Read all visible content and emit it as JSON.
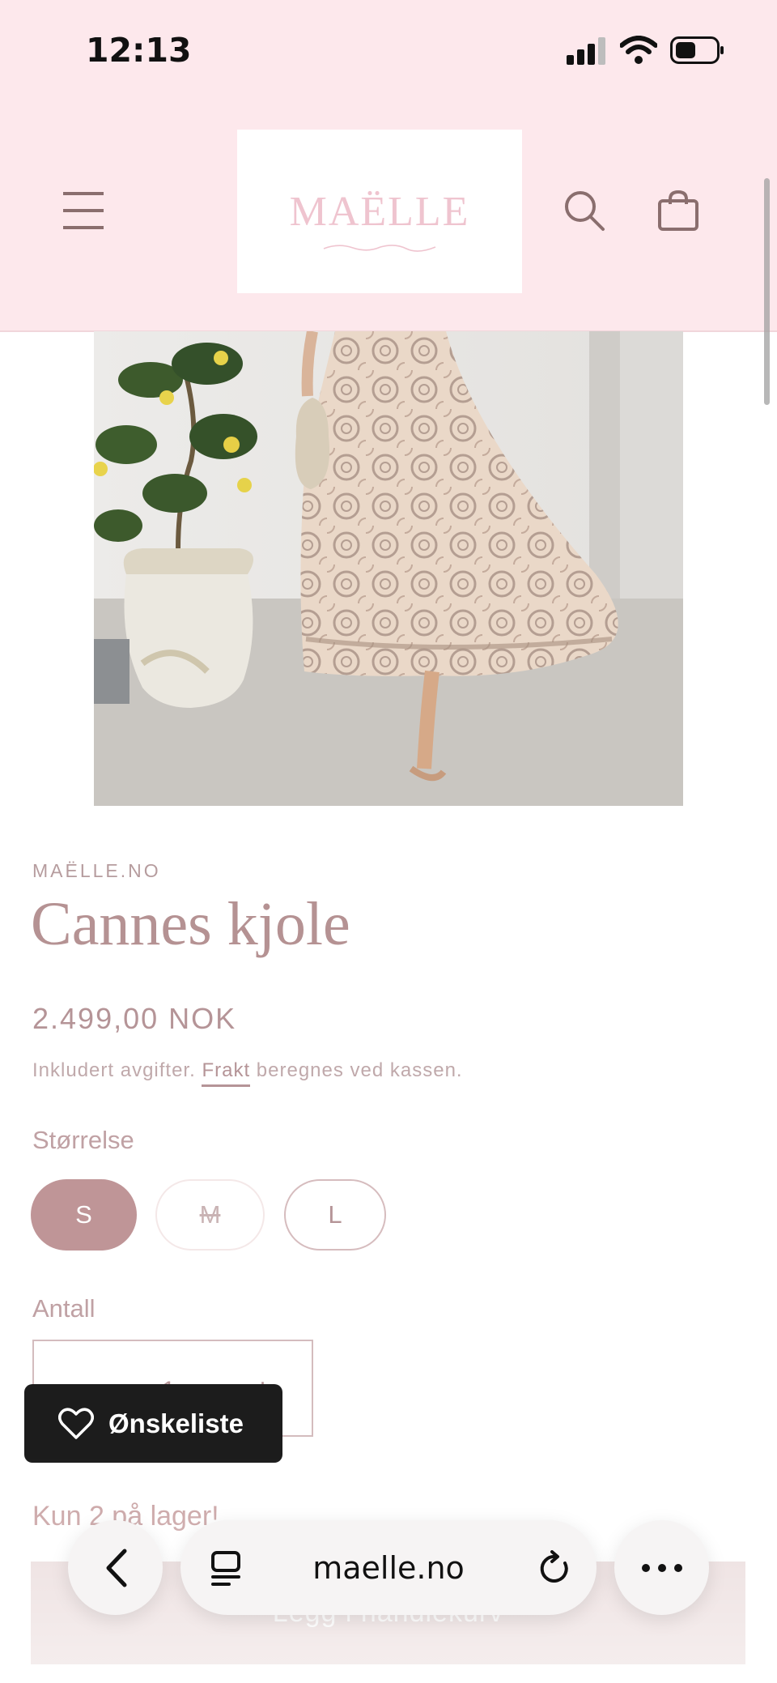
{
  "status_bar": {
    "time": "12:13"
  },
  "header": {
    "logo_text": "MAËLLE"
  },
  "product": {
    "vendor": "MAËLLE.NO",
    "title": "Cannes kjole",
    "price": "2.499,00 NOK",
    "tax_prefix": "Inkludert avgifter. ",
    "shipping_link": "Frakt",
    "tax_suffix": " beregnes ved kassen."
  },
  "size": {
    "label": "Størrelse",
    "options": [
      {
        "label": "S",
        "state": "selected"
      },
      {
        "label": "M",
        "state": "unavailable"
      },
      {
        "label": "L",
        "state": "available"
      }
    ]
  },
  "quantity": {
    "label": "Antall",
    "value": "1",
    "increase_symbol": "+"
  },
  "stock_note": "Kun 2 på lager!",
  "add_to_cart_label": "Legg i handlekurv",
  "wishlist": {
    "label": "Ønskeliste"
  },
  "browser": {
    "url": "maelle.no"
  },
  "colors": {
    "header_bg": "#fde8ec",
    "accent": "#bf9597",
    "text": "#b59497",
    "wishlist_bg": "#1c1c1c"
  }
}
